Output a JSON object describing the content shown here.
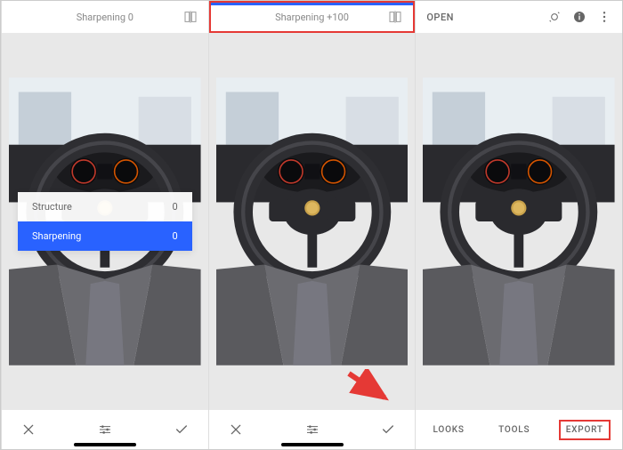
{
  "screen1": {
    "title": "Sharpening 0",
    "adjustments": {
      "structure_label": "Structure",
      "structure_value": "0",
      "sharpening_label": "Sharpening",
      "sharpening_value": "0"
    }
  },
  "screen2": {
    "title": "Sharpening +100"
  },
  "screen3": {
    "open_label": "OPEN",
    "tabs": {
      "looks": "LOOKS",
      "tools": "TOOLS",
      "export": "EXPORT"
    }
  },
  "icons": {
    "compare": "compare-icon",
    "close": "close-icon",
    "sliders": "sliders-icon",
    "check": "check-icon",
    "magic": "magic-icon",
    "info": "info-icon",
    "more": "more-icon"
  }
}
